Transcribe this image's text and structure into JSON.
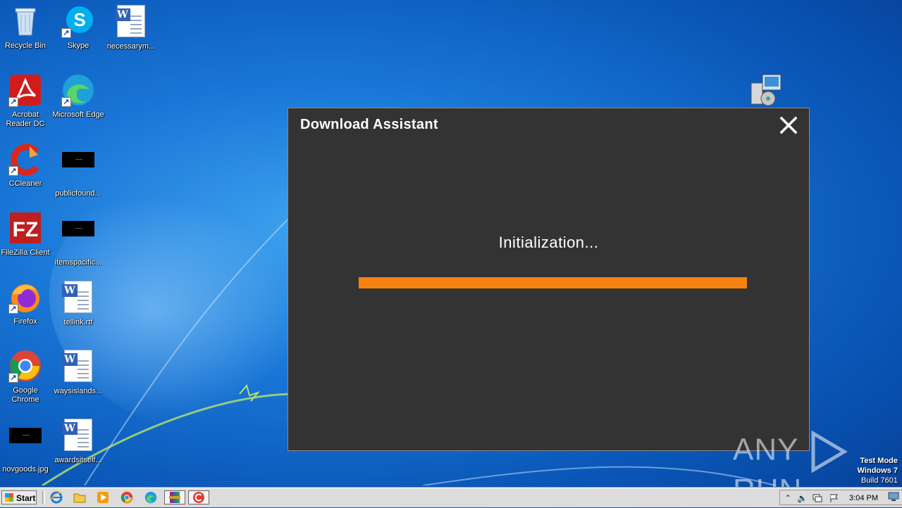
{
  "desktop": {
    "icons": [
      {
        "label": "Recycle Bin"
      },
      {
        "label": "Skype"
      },
      {
        "label": "necessarym..."
      },
      {
        "label": "Acrobat Reader DC"
      },
      {
        "label": "Microsoft Edge"
      },
      {
        "label": "CCleaner"
      },
      {
        "label": "publicfound..."
      },
      {
        "label": "FileZilla Client"
      },
      {
        "label": "itemspacific..."
      },
      {
        "label": "Firefox"
      },
      {
        "label": "tellink.rtf"
      },
      {
        "label": "Google Chrome"
      },
      {
        "label": "waysislands..."
      },
      {
        "label": "novgoods.jpg"
      },
      {
        "label": "awardsitself..."
      }
    ]
  },
  "dialog": {
    "title": "Download Assistant",
    "status": "Initialization...",
    "progress": 1.0,
    "progress_color": "#f5820f",
    "background": "#333333"
  },
  "watermark": {
    "left": "ANY",
    "right": "RUN"
  },
  "testmode": {
    "line1": "Test Mode",
    "line2": "Windows 7",
    "line3": "Build 7601"
  },
  "taskbar": {
    "start_label": "Start",
    "clock": "3:04 PM"
  }
}
